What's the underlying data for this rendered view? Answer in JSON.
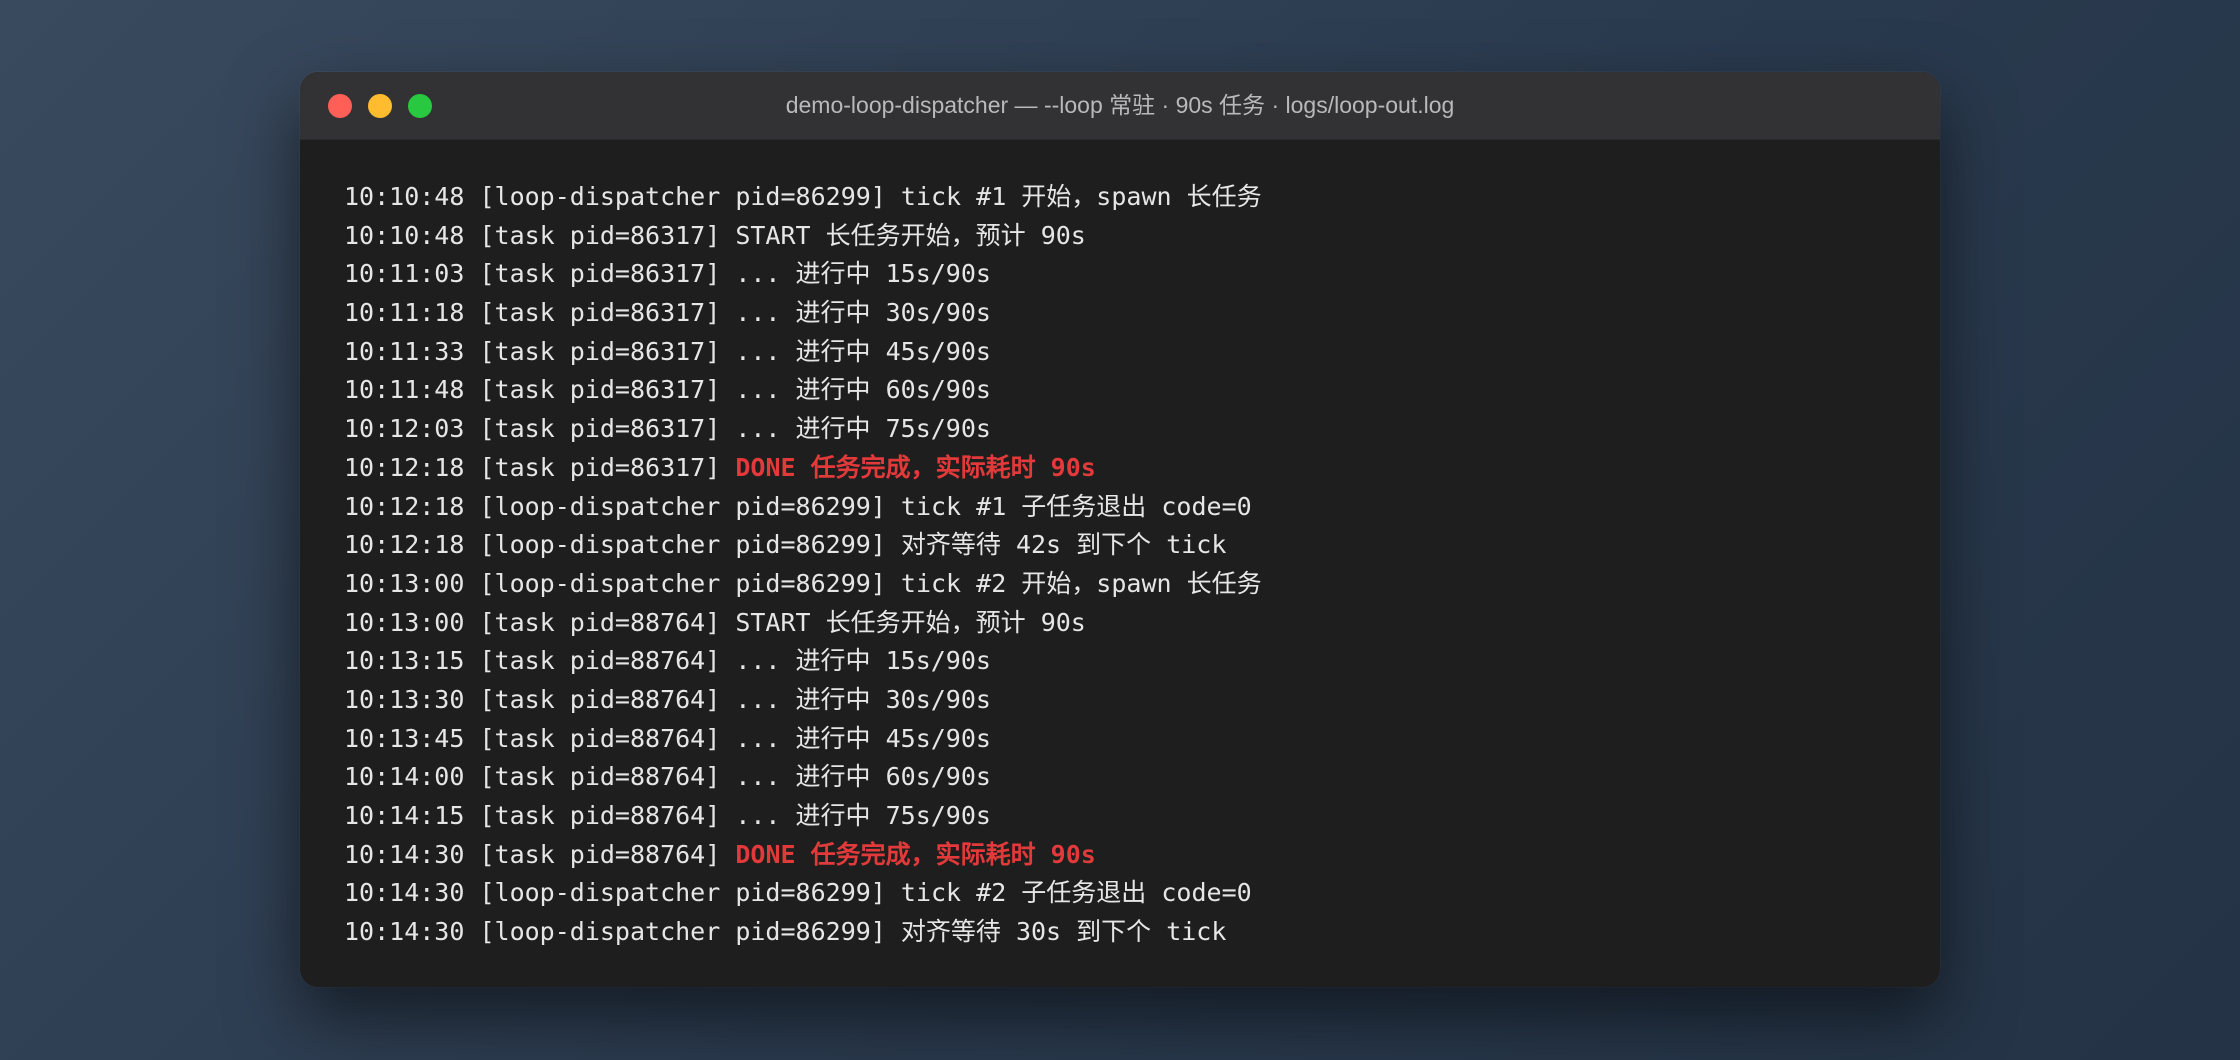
{
  "window": {
    "title": "demo-loop-dispatcher — --loop 常驻 · 90s 任务 · logs/loop-out.log"
  },
  "colors": {
    "background": "#2e3d50",
    "terminal_bg": "#1e1e1e",
    "titlebar_bg": "#323234",
    "text": "#e6e6e6",
    "done": "#e23a3a",
    "close": "#ff5f57",
    "minimize": "#febc2e",
    "maximize": "#28c840"
  },
  "log_lines": [
    {
      "prefix": "10:10:48 [loop-dispatcher pid=86299] tick #1 开始，spawn 长任务",
      "highlight": ""
    },
    {
      "prefix": "10:10:48 [task pid=86317] START 长任务开始，预计 90s",
      "highlight": ""
    },
    {
      "prefix": "10:11:03 [task pid=86317] ... 进行中 15s/90s",
      "highlight": ""
    },
    {
      "prefix": "10:11:18 [task pid=86317] ... 进行中 30s/90s",
      "highlight": ""
    },
    {
      "prefix": "10:11:33 [task pid=86317] ... 进行中 45s/90s",
      "highlight": ""
    },
    {
      "prefix": "10:11:48 [task pid=86317] ... 进行中 60s/90s",
      "highlight": ""
    },
    {
      "prefix": "10:12:03 [task pid=86317] ... 进行中 75s/90s",
      "highlight": ""
    },
    {
      "prefix": "10:12:18 [task pid=86317] ",
      "highlight": "DONE 任务完成，实际耗时 90s"
    },
    {
      "prefix": "10:12:18 [loop-dispatcher pid=86299] tick #1 子任务退出 code=0",
      "highlight": ""
    },
    {
      "prefix": "10:12:18 [loop-dispatcher pid=86299] 对齐等待 42s 到下个 tick",
      "highlight": ""
    },
    {
      "prefix": "10:13:00 [loop-dispatcher pid=86299] tick #2 开始，spawn 长任务",
      "highlight": ""
    },
    {
      "prefix": "10:13:00 [task pid=88764] START 长任务开始，预计 90s",
      "highlight": ""
    },
    {
      "prefix": "10:13:15 [task pid=88764] ... 进行中 15s/90s",
      "highlight": ""
    },
    {
      "prefix": "10:13:30 [task pid=88764] ... 进行中 30s/90s",
      "highlight": ""
    },
    {
      "prefix": "10:13:45 [task pid=88764] ... 进行中 45s/90s",
      "highlight": ""
    },
    {
      "prefix": "10:14:00 [task pid=88764] ... 进行中 60s/90s",
      "highlight": ""
    },
    {
      "prefix": "10:14:15 [task pid=88764] ... 进行中 75s/90s",
      "highlight": ""
    },
    {
      "prefix": "10:14:30 [task pid=88764] ",
      "highlight": "DONE 任务完成，实际耗时 90s"
    },
    {
      "prefix": "10:14:30 [loop-dispatcher pid=86299] tick #2 子任务退出 code=0",
      "highlight": ""
    },
    {
      "prefix": "10:14:30 [loop-dispatcher pid=86299] 对齐等待 30s 到下个 tick",
      "highlight": ""
    }
  ]
}
